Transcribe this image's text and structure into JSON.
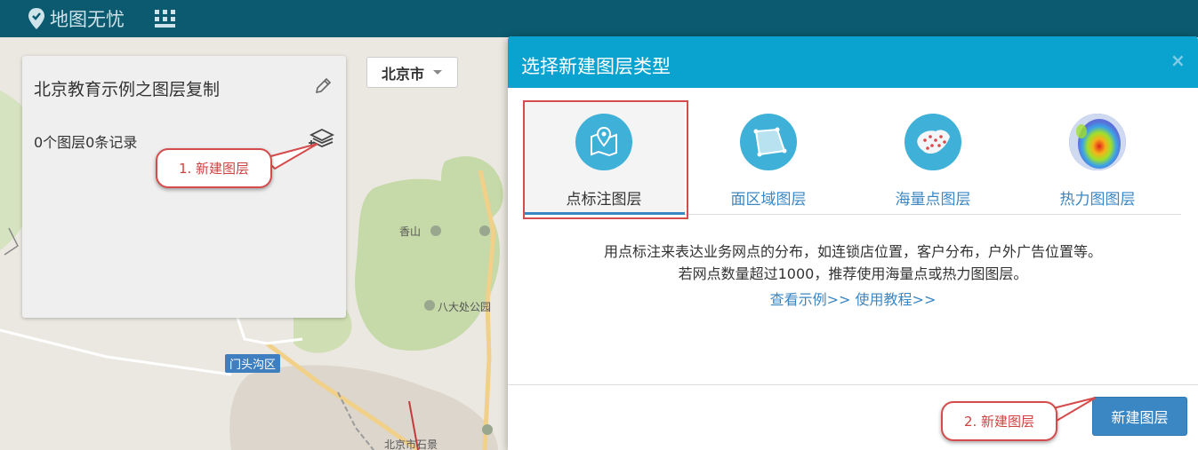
{
  "app": {
    "logo_text": "地图无忧"
  },
  "map": {
    "city_select": "北京市",
    "labels": [
      "香山",
      "八大处公园",
      "北京市石景",
      "门头沟区"
    ],
    "district_badge": "门头沟区"
  },
  "panel": {
    "title": "北京教育示例之图层复制",
    "count": "0个图层0条记录"
  },
  "callouts": {
    "step1": "1. 新建图层",
    "step2": "2. 新建图层"
  },
  "dialog": {
    "title": "选择新建图层类型",
    "close": "×",
    "types": [
      {
        "label": "点标注图层",
        "icon": "map-marker-icon",
        "selected": true
      },
      {
        "label": "面区域图层",
        "icon": "polygon-area-icon",
        "selected": false
      },
      {
        "label": "海量点图层",
        "icon": "china-dots-icon",
        "selected": false
      },
      {
        "label": "热力图图层",
        "icon": "heatmap-icon",
        "selected": false
      }
    ],
    "description_line1": "用点标注来表达业务网点的分布，如连锁店位置，客户分布，户外广告位置等。",
    "description_line2": "若网点数量超过1000，推荐使用海量点或热力图图层。",
    "link_example": "查看示例>>",
    "link_tutorial": "使用教程>>",
    "create_button": "新建图层"
  },
  "colors": {
    "topbar": "#0b5a6f",
    "dialog_header": "#0aa3cf",
    "accent_blue": "#3b87c3",
    "callout_red": "#d64b4b"
  }
}
